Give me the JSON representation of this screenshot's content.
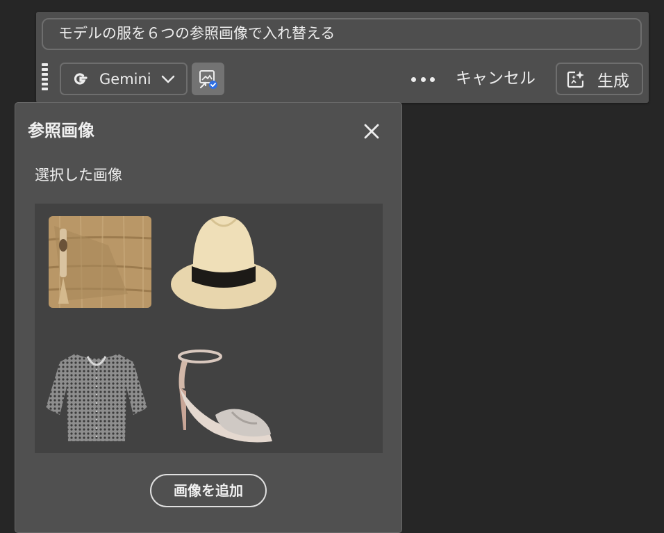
{
  "toolbar": {
    "prompt": "モデルの服を６つの参照画像で入れ替える",
    "model_label": "Gemini",
    "cancel_label": "キャンセル",
    "generate_label": "生成"
  },
  "panel": {
    "title": "参照画像",
    "section_label": "選択した画像",
    "add_button_label": "画像を追加",
    "images": [
      {
        "icon": "straw-clutch-bag"
      },
      {
        "icon": "panama-hat"
      },
      {
        "icon": "patterned-blouse"
      },
      {
        "icon": "high-heel-sandal"
      }
    ]
  },
  "colors": {
    "background": "#262626",
    "toolbar": "#4e4e4e",
    "panel": "#505050",
    "grid": "#424242",
    "accent_check": "#2f6fe4"
  }
}
